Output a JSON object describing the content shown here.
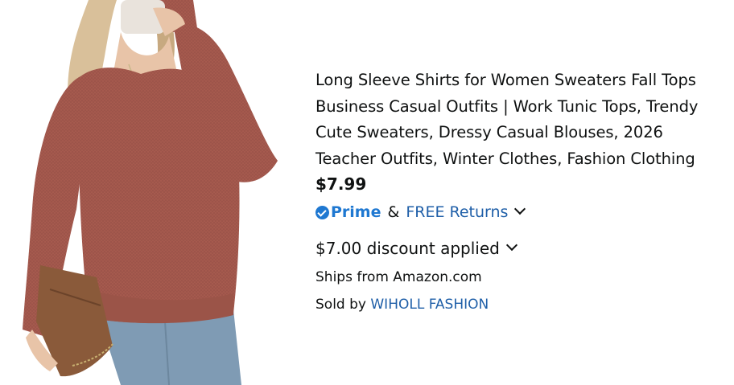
{
  "product": {
    "title_lines": [
      "Long Sleeve Shirts for Women Sweaters Fall Tops",
      "Business Casual Outfits | Work Tunic Tops, Trendy",
      "Cute Sweaters, Dressy Casual Blouses, 2026",
      "Teacher Outfits, Winter Clothes, Fashion Clothing"
    ],
    "price": "$7.99",
    "prime_label": "Prime",
    "ampersand": "&",
    "free_returns": "FREE Returns",
    "discount": "$7.00 discount applied",
    "ships_from": "Ships from Amazon.com",
    "sold_by_prefix": "Sold by",
    "seller": "WIHOLL FASHION"
  },
  "colors": {
    "prime_blue": "#1f78d1",
    "link_blue": "#1f5fa8",
    "sweater": "#a65a4e"
  },
  "icons": {
    "prime": "prime-check-icon",
    "chevron": "chevron-down-icon"
  }
}
